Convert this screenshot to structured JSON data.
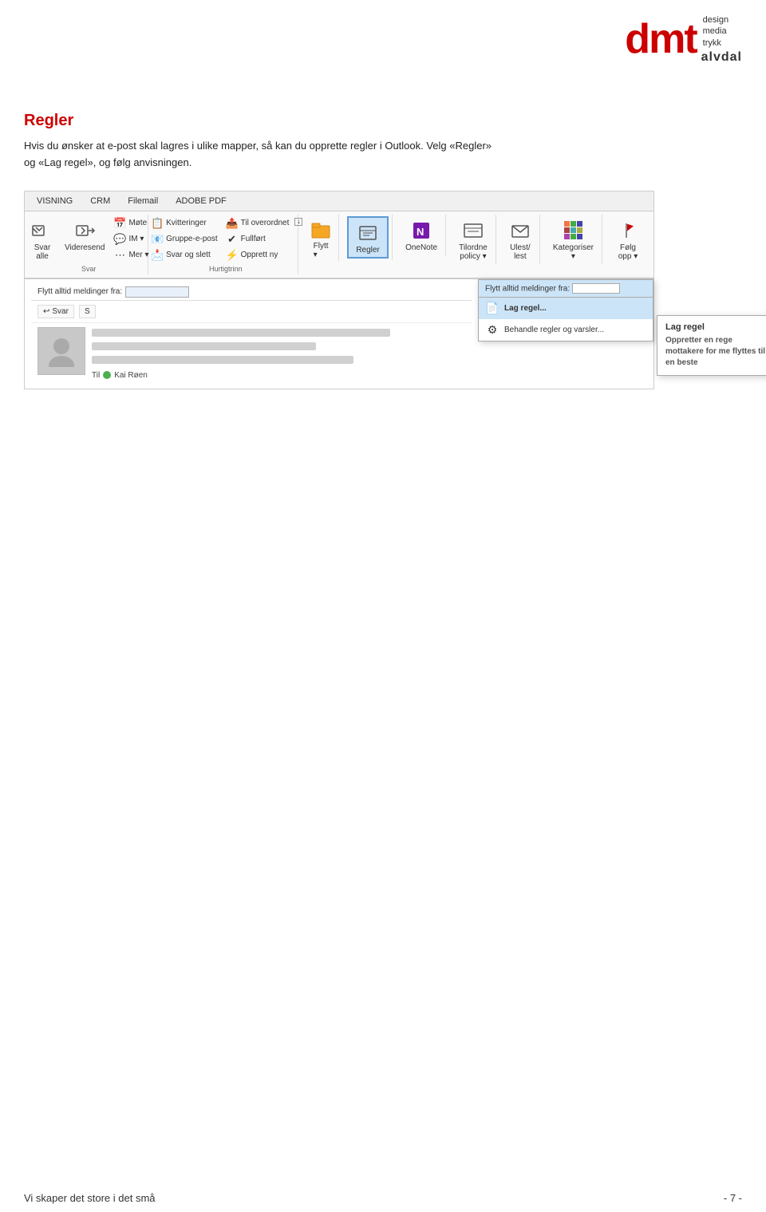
{
  "logo": {
    "dmt": "dmt",
    "tagline_design": "design",
    "tagline_media": "media",
    "tagline_trykk": "trykk",
    "alvdal": "alvdal"
  },
  "section": {
    "title": "Regler",
    "body_line1": "Hvis du ønsker at e-post skal lagres i ulike mapper, så kan du opprette regler i Outlook. Velg «Regler»",
    "body_line2": "og «Lag regel», og følg anvisningen."
  },
  "ribbon": {
    "tabs": [
      "VISNING",
      "CRM",
      "Filemail",
      "ADOBE PDF"
    ],
    "groups": {
      "svar": {
        "label": "Svar",
        "svar_all_label": "Svar\nalle",
        "videresend_label": "Videresend",
        "mote_label": "Møte",
        "im_label": "IM ▾",
        "mer_label": "Mer ▾"
      },
      "hurtigtrinn": {
        "label": "Hurtigtrinn",
        "items": [
          "Kvitteringer",
          "Gruppe-e-post",
          "Svar og slett",
          "Til overordnet",
          "Fullført",
          "Opprett ny"
        ]
      },
      "flytt": {
        "label": "Flytt",
        "flytt_label": "Flytt\n▾"
      },
      "regler": {
        "label": "Regler",
        "flytt_alltid": "Flytt alltid meldinger fra:",
        "lag_regel": "Lag regel...",
        "behandle": "Behandle regler og varsler..."
      },
      "onenote": {
        "label": "OneNote"
      },
      "tilordne": {
        "label": "Tilordne\npolicy ▾"
      },
      "ulest": {
        "label": "Ulest/\nlest"
      },
      "kategoriser": {
        "label": "Kategoriser\n▾"
      },
      "folg": {
        "label": "Følg\nopp ▾"
      }
    }
  },
  "tooltip": {
    "title": "Lag regel",
    "body": "Oppretter en rege mottakere for me flyttes til en beste"
  },
  "email_preview": {
    "reply_btn": "Svar",
    "to_label": "Til",
    "to_name": "Kai Røen"
  },
  "footer": {
    "left": "Vi skaper det store i det små",
    "right": "- 7 -"
  }
}
